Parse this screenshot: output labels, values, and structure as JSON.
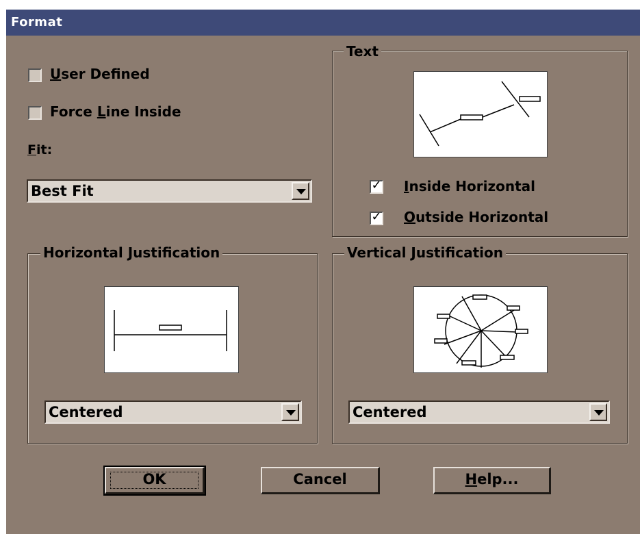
{
  "window": {
    "title": "Format"
  },
  "left": {
    "user_defined": {
      "label_u": "U",
      "label_rest": "ser Defined",
      "checked": false
    },
    "force_line": {
      "label_pre": "Force ",
      "label_u": "L",
      "label_rest": "ine Inside",
      "checked": false
    },
    "fit": {
      "label_u": "F",
      "label_rest": "it:",
      "value": "Best Fit"
    }
  },
  "text_group": {
    "title": "Text",
    "inside_horizontal": {
      "label_u": "I",
      "label_rest": "nside Horizontal",
      "checked": true
    },
    "outside_horizontal": {
      "label_u": "O",
      "label_rest": "utside Horizontal",
      "checked": true
    },
    "check_glyph": "✓"
  },
  "horizontal_group": {
    "title": "Horizontal Justification",
    "value": "Centered"
  },
  "vertical_group": {
    "title": "Vertical Justification",
    "value": "Centered"
  },
  "buttons": {
    "ok": "OK",
    "cancel": "Cancel",
    "help_u": "H",
    "help_rest": "elp..."
  }
}
